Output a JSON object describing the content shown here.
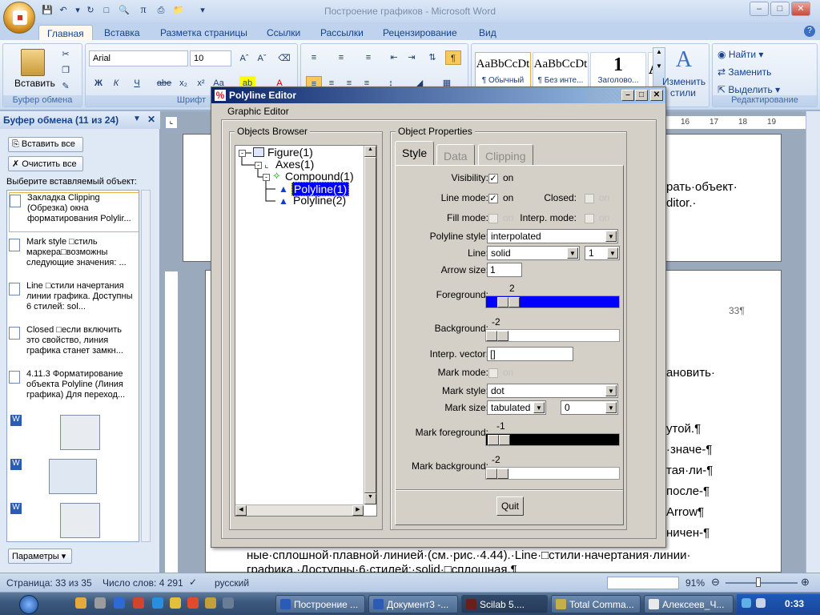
{
  "word": {
    "window_title": "Построение графиков - Microsoft Word",
    "tabs": [
      "Главная",
      "Вставка",
      "Разметка страницы",
      "Ссылки",
      "Рассылки",
      "Рецензирование",
      "Вид"
    ],
    "ribbon": {
      "paste_label": "Вставить",
      "clipboard_group": "Буфер обмена",
      "font_group": "Шрифт",
      "font_name": "Arial",
      "font_size": "10",
      "styles": [
        {
          "preview": "AaBbCcDt",
          "label": "¶ Обычный"
        },
        {
          "preview": "AaBbCcDt",
          "label": "¶ Без инте..."
        },
        {
          "preview": "1",
          "label": "Заголово..."
        },
        {
          "preview": "A:",
          "label": ""
        }
      ],
      "change_styles_1": "Изменить",
      "change_styles_2": "стили",
      "find": "Найти",
      "replace": "Заменить",
      "select": "Выделить",
      "editing_group": "Редактирование"
    },
    "clipboard_pane": {
      "header": "Буфер обмена (11 из 24)",
      "paste_all": "Вставить все",
      "clear_all": "Очистить все",
      "hint": "Выберите вставляемый объект:",
      "items": [
        "Закладка Clipping (Обрезка) окна форматирования Polylir...",
        "Mark style □стиль маркера□возможны следующие значения: ...",
        "Line □стили начертания линии графика. Доступны 6 стилей: sol...",
        "Closed □если включить это свойство, линия графика станет замкн...",
        "4.11.3 Форматирование объекта Polyline (Линия графика) Для переход..."
      ],
      "options_button": "Параметры"
    },
    "ruler_marks": [
      "16",
      "17",
      "18",
      "19"
    ],
    "doc_right_text": [
      "рать·объект·",
      "ditor.·",
      "33¶",
      "ановить·",
      "утой.¶",
      "·значе-¶",
      "тая·ли-¶",
      "после-¶",
      "Arrow¶",
      "ничен-¶"
    ],
    "doc_bottom_text": [
      "ные·сплошной·плавной·линией·(см.·рис.·4.44).·Line·□стили·начертания·линии·",
      "графика.·Доступны·6·стилей:·solid·□сплошная,¶"
    ],
    "status": {
      "page": "Страница: 33 из 35",
      "words": "Число слов: 4 291",
      "language": "русский",
      "zoom": "91%"
    }
  },
  "taskbar": {
    "buttons": [
      "Построение ...",
      "Документ3 -...",
      "Scilab 5....",
      "Total Comma...",
      "Алексеев_Ч..."
    ],
    "time": "0:33"
  },
  "editor": {
    "title": "Polyline Editor",
    "menu": "Graphic Editor",
    "objects_browser": "Objects Browser",
    "tree": [
      "Figure(1)",
      "Axes(1)",
      "Compound(1)",
      "Polyline(1)",
      "Polyline(2)"
    ],
    "object_properties": "Object Properties",
    "tabs": [
      "Style",
      "Data",
      "Clipping"
    ],
    "props": {
      "visibility_label": "Visibility:",
      "visibility_value": "on",
      "line_mode_label": "Line mode:",
      "line_mode_value": "on",
      "closed_label": "Closed:",
      "closed_value": "on",
      "fill_mode_label": "Fill mode:",
      "fill_mode_value": "on",
      "interp_mode_label": "Interp. mode:",
      "interp_mode_value": "on",
      "polyline_style_label": "Polyline style:",
      "polyline_style_value": "interpolated",
      "line_label": "Line:",
      "line_style_value": "solid",
      "line_width_value": "1",
      "arrow_size_label": "Arrow size:",
      "arrow_size_value": "1",
      "foreground_label": "Foreground:",
      "foreground_value": "2",
      "background_label": "Background:",
      "background_value": "-2",
      "interp_vector_label": "Interp. vector:",
      "interp_vector_value": "[]",
      "mark_mode_label": "Mark mode:",
      "mark_mode_value": "on",
      "mark_style_label": "Mark style:",
      "mark_style_value": "dot",
      "mark_size_label": "Mark size:",
      "mark_size_unit": "tabulated",
      "mark_size_value": "0",
      "mark_fg_label": "Mark foreground:",
      "mark_fg_value": "-1",
      "mark_bg_label": "Mark background:",
      "mark_bg_value": "-2"
    },
    "quit": "Quit",
    "colors": {
      "foreground": "#0000ff",
      "mark_foreground": "#000000",
      "tree_selected": "#0000ff"
    }
  }
}
